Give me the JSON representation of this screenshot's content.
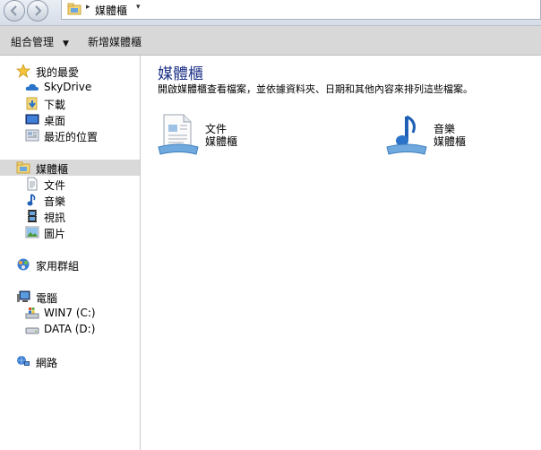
{
  "address": {
    "crumb": "媒體櫃"
  },
  "toolbar": {
    "organize": "組合管理",
    "new_library": "新增媒體櫃"
  },
  "nav": {
    "favorites": {
      "label": "我的最愛",
      "items": [
        {
          "label": "SkyDrive",
          "icon": "cloud-icon"
        },
        {
          "label": "下載",
          "icon": "downloads-folder-icon"
        },
        {
          "label": "桌面",
          "icon": "desktop-icon"
        },
        {
          "label": "最近的位置",
          "icon": "recent-places-icon"
        }
      ]
    },
    "libraries": {
      "label": "媒體櫃",
      "items": [
        {
          "label": "文件",
          "icon": "document-icon"
        },
        {
          "label": "音樂",
          "icon": "music-note-icon"
        },
        {
          "label": "視訊",
          "icon": "film-icon"
        },
        {
          "label": "圖片",
          "icon": "picture-icon"
        }
      ]
    },
    "homegroup": {
      "label": "家用群組"
    },
    "computer": {
      "label": "電腦",
      "items": [
        {
          "label": "WIN7 (C:)",
          "icon": "system-drive-icon"
        },
        {
          "label": "DATA (D:)",
          "icon": "drive-icon"
        }
      ]
    },
    "network": {
      "label": "網路"
    }
  },
  "content": {
    "title": "媒體櫃",
    "description": "開啟媒體櫃查看檔案，並依據資料夾、日期和其他內容來排列這些檔案。",
    "libraries": [
      {
        "name": "文件",
        "type": "媒體櫃",
        "icon": "documents-library-icon"
      },
      {
        "name": "音樂",
        "type": "媒體櫃",
        "icon": "music-library-icon"
      }
    ]
  },
  "colors": {
    "title_blue": "#1e3287",
    "selected_bg": "#d9d9d9",
    "toolbar_bg": "#d8d8d8"
  }
}
